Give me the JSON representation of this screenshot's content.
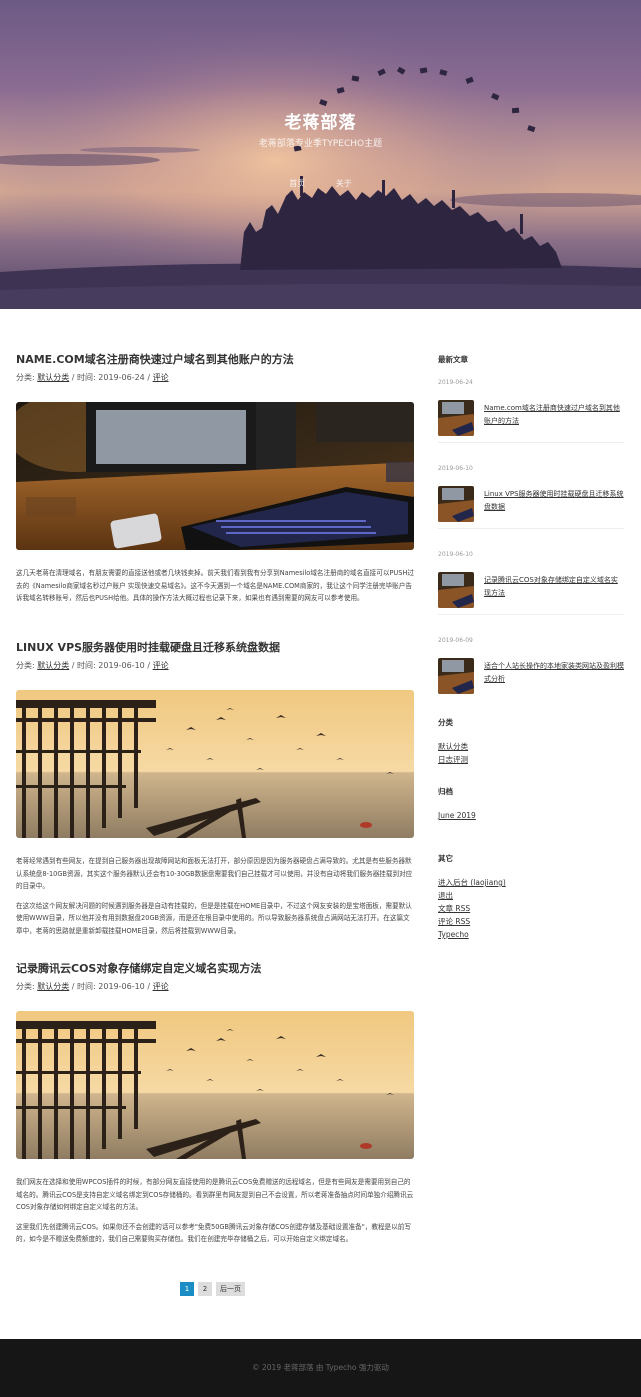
{
  "site": {
    "title": "老蒋部落",
    "description": "老蒋部落专业季TYPECHO主题",
    "nav": [
      "首页",
      "关于"
    ]
  },
  "posts": [
    {
      "title": "NAME.COM域名注册商快速过户域名到其他账户的方法",
      "meta_category_label": "分类:",
      "category": "默认分类",
      "meta_time_label": "/ 时间:",
      "date": "2019-06-24",
      "comments_label": "评论",
      "thumb": "desk-keyboard",
      "excerpt": [
        "这几天老蒋在清理域名，有朋友需要的直接送他或者几块钱卖掉。前天我们看到我有分享到Namesilo域名注册商的域名直接可以PUSH过去的《Namesilo商家域名秒过户账户 实现快速交易域名》。这不今天遇到一个域名是NAME.COM商家的，我让这个同学注册完毕账户告诉我域名转移账号，然后也PUSH给他。具体的操作方法大概过程也记录下来，如果也有遇到需要的网友可以参考使用。"
      ]
    },
    {
      "title": "LINUX VPS服务器使用时挂载硬盘且迁移系统盘数据",
      "meta_category_label": "分类:",
      "category": "默认分类",
      "meta_time_label": "/ 时间:",
      "date": "2019-06-10",
      "comments_label": "评论",
      "thumb": "pier-birds",
      "excerpt": [
        "老蒋经常遇到有些网友，在提到自己服务器出现故障网站和面板无法打开，部分原因是因为服务器硬盘占满导致的。尤其是有些服务器默认系统盘8-10GB资源，其实这个服务器默认还会有10-30GB数据盘需要我们自己挂载才可以使用，并没有自动将我们服务器挂载到对应的目录中。",
        "在这次给这个网友解决问题的时候遇到服务器是自动有挂载的，但是是挂载在HOME目录中，不过这个网友安装的是宝塔面板，需要默认使用WWW目录，所以他并没有用到数据盘20GB资源，而是还在根目录中使用的。所以导致服务器系统盘占满网站无法打开。在这篇文章中，老蒋的思路就是重新卸载挂载HOME目录，然后将挂载到WWW目录。"
      ]
    },
    {
      "title": "记录腾讯云COS对象存储绑定自定义域名实现方法",
      "meta_category_label": "分类:",
      "category": "默认分类",
      "meta_time_label": "/ 时间:",
      "date": "2019-06-10",
      "comments_label": "评论",
      "thumb": "pier-birds",
      "excerpt": [
        "我们网友在选择和使用WPCOS插件的时候，有部分网友直接使用的是腾讯云COS免费赠送的远程域名，但是有些网友是需要用到自己的域名的。腾讯云COS是支持自定义域名绑定到COS存储桶的。看到群里有网友提到自己不会设置，所以老蒋准备抽点时间单独介绍腾讯云COS对象存储如何绑定自定义域名的方法。",
        "这里我们先创建腾讯云COS。如果你还不会创建的话可以参考\"免费50GB腾讯云对象存储COS创建存储及基础设置准备\"，教程是以前写的，如今是不赠送免费额度的，我们自己需要购买存储包。我们在创建完毕存储桶之后，可以开始自定义绑定域名。"
      ]
    }
  ],
  "pagination": {
    "pages": [
      "1",
      "2"
    ],
    "current": "1",
    "next_label": "后一页"
  },
  "sidebar": {
    "recent_title": "最新文章",
    "recent": [
      {
        "date": "2019-06-24",
        "title": "Name.com域名注册商快速过户域名到其他账户的方法"
      },
      {
        "date": "2019-06-10",
        "title": "Linux VPS服务器使用时挂载硬盘且迁移系统盘数据"
      },
      {
        "date": "2019-06-10",
        "title": "记录腾讯云COS对象存储绑定自定义域名实现方法"
      },
      {
        "date": "2019-06-09",
        "title": "适合个人站长操作的本地家装类网站及盈利模式分析"
      }
    ],
    "categories_title": "分类",
    "categories": [
      "默认分类",
      "日志评测"
    ],
    "archive_title": "归档",
    "archives": [
      "June 2019"
    ],
    "other_title": "其它",
    "other": [
      "进入后台 (laojiang)",
      "退出",
      "文章 RSS",
      "评论 RSS",
      "Typecho"
    ]
  },
  "footer": {
    "copyright": "© 2019",
    "site_name": "老蒋部落",
    "by": "由",
    "powered": "Typecho",
    "suffix": "强力驱动"
  },
  "colors": {
    "accent": "#1b8dc4",
    "footer_bg": "#161616"
  }
}
